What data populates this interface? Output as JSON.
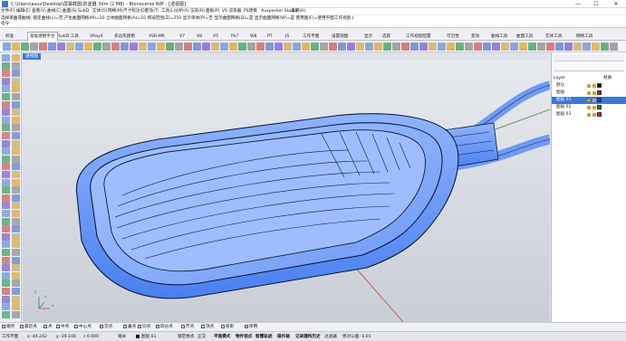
{
  "titlebar": {
    "title": "C:\\Users\\asus\\Desktop\\屏幕截图\\防盗器.3dm (2 MB) - Rhinoceros WIP - [透视图]",
    "min": "—",
    "max": "☐",
    "close": "✕"
  },
  "menubar": {
    "items": [
      "文件(F)",
      "编辑(E)",
      "查看(V)",
      "曲线(C)",
      "曲面(S)",
      "SubD",
      "实体(O)",
      "网格(M)",
      "尺寸标注(D)",
      "变动(T)",
      "工具(L)",
      "分析(A)",
      "渲染(R)",
      "面板(P)",
      "V5.渲染器",
      "PS建模",
      "Auxpecker Studio",
      "说明(H)"
    ]
  },
  "command": {
    "history": "选择单曲或曲线( 锁定曲线(L)=否  产生曲面网格(M)=10  立体曲面网格(A)=10  增减范围(Z)=250  显示单体(P)=否  显示曲面网格(D)=是  显示曲面网格(W)=是  使用图(F)=使用平面工作视窗 )",
    "prompt": "指令:"
  },
  "tabs": [
    "标准",
    "基础建模平台",
    "SubD 工具",
    "VRay4",
    "多边形建模",
    "VSR-MR",
    "V7",
    "V8",
    "V5",
    "Pe7",
    "W8",
    "PT",
    "JS",
    "工作平面",
    "设置视图",
    "显示",
    "选取",
    "工作视窗配置",
    "可见性",
    "变动",
    "曲线工具",
    "曲面工具",
    "实体工具",
    "网格工具"
  ],
  "active_tab_index": 1,
  "viewport": {
    "label": "透视图",
    "axis_x": "x",
    "axis_y": "y",
    "axis_z": "z"
  },
  "layers_panel": {
    "header_label": "Layer",
    "col_material": "材质",
    "layers": [
      {
        "name": "默认",
        "color": "#111111"
      },
      {
        "name": "图层",
        "color": "#cc1111"
      },
      {
        "name": "图层 01",
        "color": "#1c3d9a",
        "selected": true
      },
      {
        "name": "图层 02",
        "color": "#1a8a1a"
      },
      {
        "name": "图层 03",
        "color": "#e21d1d"
      }
    ]
  },
  "osnap": [
    {
      "label": "端点",
      "on": false
    },
    {
      "label": "最近点",
      "on": false
    },
    {
      "label": "点",
      "on": false
    },
    {
      "label": "中点",
      "on": false
    },
    {
      "label": "中心点",
      "on": false
    },
    {
      "label": "交点",
      "on": false
    },
    {
      "label": "垂点",
      "on": false
    },
    {
      "label": "切点",
      "on": false
    },
    {
      "label": "四分点",
      "on": false
    },
    {
      "label": "节点",
      "on": false
    },
    {
      "label": "顶点",
      "on": false
    },
    {
      "label": "投影",
      "on": false
    },
    {
      "label": "停用",
      "on": false
    }
  ],
  "status": {
    "plane": "工作平面",
    "x": "x -44.242",
    "y": "y -19.106",
    "z": "z 0.000",
    "unit": "毫米",
    "layer": "图层 01",
    "items": [
      "锁定格点",
      "正交",
      "平面模式",
      "物件锁点",
      "智慧轨迹",
      "操作轴",
      "记录建构历史",
      "过滤器",
      "绝对公差: 0.01"
    ]
  }
}
